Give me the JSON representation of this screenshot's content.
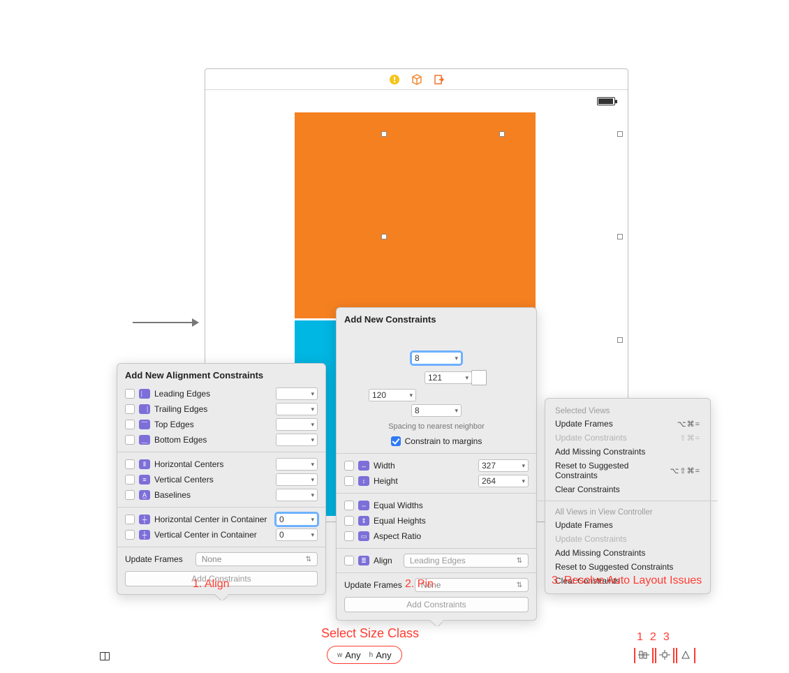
{
  "align": {
    "title": "Add New Alignment Constraints",
    "items": [
      {
        "label": "Leading Edges"
      },
      {
        "label": "Trailing Edges"
      },
      {
        "label": "Top Edges"
      },
      {
        "label": "Bottom Edges"
      }
    ],
    "centers": [
      {
        "label": "Horizontal Centers"
      },
      {
        "label": "Vertical Centers"
      },
      {
        "label": "Baselines"
      }
    ],
    "container": [
      {
        "label": "Horizontal Center in Container",
        "value": "0",
        "highlight": true
      },
      {
        "label": "Vertical Center in Container",
        "value": "0",
        "highlight": false
      }
    ],
    "update_label": "Update Frames",
    "update_value": "None",
    "add_label": "Add Constraints"
  },
  "pin": {
    "title": "Add New Constraints",
    "top": "8",
    "left": "121",
    "right": "120",
    "bottom": "8",
    "spacing_label": "Spacing to nearest neighbor",
    "constrain_margins": "Constrain to margins",
    "constrain_checked": true,
    "width_label": "Width",
    "width_value": "327",
    "height_label": "Height",
    "height_value": "264",
    "equal_widths": "Equal Widths",
    "equal_heights": "Equal Heights",
    "aspect_ratio": "Aspect Ratio",
    "align_label": "Align",
    "align_value": "Leading Edges",
    "update_label": "Update Frames",
    "update_value": "None",
    "add_label": "Add Constraints"
  },
  "resolve": {
    "group1_title": "Selected Views",
    "group2_title": "All Views in View Controller",
    "g1": [
      {
        "label": "Update Frames",
        "shortcut": "⌥⌘=",
        "disabled": false
      },
      {
        "label": "Update Constraints",
        "shortcut": "⇧⌘=",
        "disabled": true
      },
      {
        "label": "Add Missing Constraints",
        "shortcut": "",
        "disabled": false
      },
      {
        "label": "Reset to Suggested Constraints",
        "shortcut": "⌥⇧⌘=",
        "disabled": false
      },
      {
        "label": "Clear Constraints",
        "shortcut": "",
        "disabled": false
      }
    ],
    "g2": [
      {
        "label": "Update Frames",
        "shortcut": "",
        "disabled": false
      },
      {
        "label": "Update Constraints",
        "shortcut": "",
        "disabled": true
      },
      {
        "label": "Add Missing Constraints",
        "shortcut": "",
        "disabled": false
      },
      {
        "label": "Reset to Suggested Constraints",
        "shortcut": "",
        "disabled": false
      },
      {
        "label": "Clear Constraints",
        "shortcut": "",
        "disabled": false
      }
    ]
  },
  "captions": {
    "align": "1. Align",
    "pin": "2. Pin",
    "resolve": "3. Resolve Auto Layout Issues",
    "size_class": "Select Size Class",
    "n1": "1",
    "n2": "2",
    "n3": "3"
  },
  "size_class": {
    "w_prefix": "w",
    "w_value": "Any",
    "h_prefix": "h",
    "h_value": "Any"
  }
}
